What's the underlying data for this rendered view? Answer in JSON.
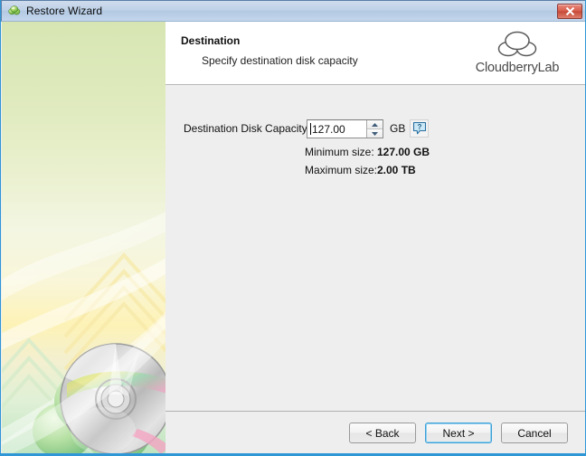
{
  "window": {
    "title": "Restore Wizard",
    "title_icon": "cloudberry-app-icon",
    "close_label": "x"
  },
  "header": {
    "title": "Destination",
    "subtitle": "Specify destination disk capacity",
    "logo_text": "CloudberryLab",
    "logo_icon": "cloud-icon"
  },
  "sidebar": {
    "graphic": "disc-over-green-cloud-artwork"
  },
  "form": {
    "capacity_label": "Destination Disk Capacity:",
    "capacity_value": "127.00",
    "capacity_unit": "GB",
    "help_icon": "help-question-icon",
    "info": [
      {
        "key": "Minimum size:",
        "value": "127.00 GB"
      },
      {
        "key": "Maximum size:",
        "value": "2.00 TB"
      }
    ]
  },
  "footer": {
    "back_label": "< Back",
    "next_label": "Next >",
    "cancel_label": "Cancel"
  },
  "colors": {
    "accent_blue": "#2f97d6",
    "titlebar_blue": "#bfd2e8",
    "close_red": "#d9604f",
    "pane_gray": "#eeeeee",
    "sidebar_green": "#d7e5b3",
    "sidebar_yellow": "#fdf2b6"
  }
}
